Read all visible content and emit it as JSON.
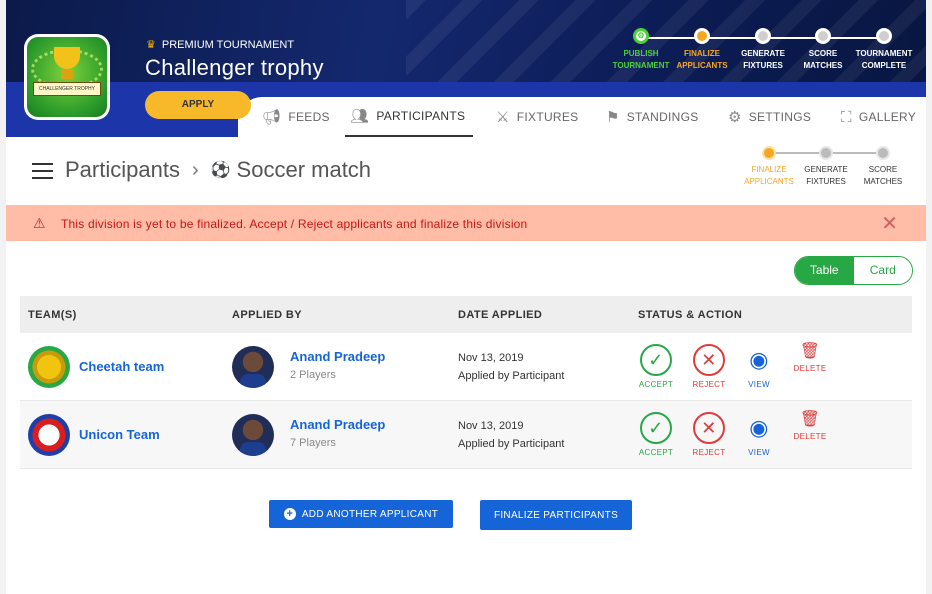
{
  "header": {
    "premium_label": "PREMIUM TOURNAMENT",
    "title": "Challenger trophy",
    "apply_label": "APPLY",
    "logo_text": "CHALLENGER TROPHY",
    "stepper": [
      {
        "line1": "PUBLISH",
        "line2": "TOURNAMENT",
        "color": "#4cd137",
        "state": "done"
      },
      {
        "line1": "FINALIZE",
        "line2": "APPLICANTS",
        "color": "#f5a623",
        "state": "current"
      },
      {
        "line1": "GENERATE",
        "line2": "FIXTURES",
        "color": "#ffffff",
        "state": "pending"
      },
      {
        "line1": "SCORE",
        "line2": "MATCHES",
        "color": "#ffffff",
        "state": "pending"
      },
      {
        "line1": "TOURNAMENT",
        "line2": "COMPLETE",
        "color": "#ffffff",
        "state": "pending"
      }
    ]
  },
  "tabs": [
    {
      "label": "FEEDS",
      "icon": "megaphone-icon"
    },
    {
      "label": "PARTICIPANTS",
      "icon": "participants-icon",
      "active": true
    },
    {
      "label": "FIXTURES",
      "icon": "fixtures-icon"
    },
    {
      "label": "STANDINGS",
      "icon": "standings-icon"
    },
    {
      "label": "SETTINGS",
      "icon": "gear-icon"
    },
    {
      "label": "GALLERY",
      "icon": "gallery-icon"
    }
  ],
  "breadcrumb": {
    "root": "Participants",
    "current": "Soccer match"
  },
  "sub_stepper": [
    {
      "line1": "FINALIZE",
      "line2": "APPLICANTS",
      "color": "#f5a623"
    },
    {
      "line1": "GENERATE",
      "line2": "FIXTURES",
      "color": "#333333"
    },
    {
      "line1": "SCORE",
      "line2": "MATCHES",
      "color": "#333333"
    }
  ],
  "alert": {
    "text": "This division is yet to be finalized. Accept / Reject applicants and finalize this division"
  },
  "view_toggle": {
    "table_label": "Table",
    "card_label": "Card",
    "selected": "Table"
  },
  "table": {
    "headers": [
      "TEAM(S)",
      "APPLIED BY",
      "DATE APPLIED",
      "STATUS & ACTION"
    ],
    "actions": {
      "accept": "ACCEPT",
      "reject": "REJECT",
      "view": "VIEW",
      "delete": "DELETE"
    },
    "rows": [
      {
        "team": "Cheetah team",
        "applicant": "Anand Pradeep",
        "players": "2 Players",
        "date": "Nov 13, 2019",
        "applied_by": "Applied by Participant"
      },
      {
        "team": "Unicon Team",
        "applicant": "Anand Pradeep",
        "players": "7 Players",
        "date": "Nov 13, 2019",
        "applied_by": "Applied by Participant"
      }
    ]
  },
  "buttons": {
    "add_applicant": "ADD ANOTHER APPLICANT",
    "finalize": "FINALIZE PARTICIPANTS"
  }
}
